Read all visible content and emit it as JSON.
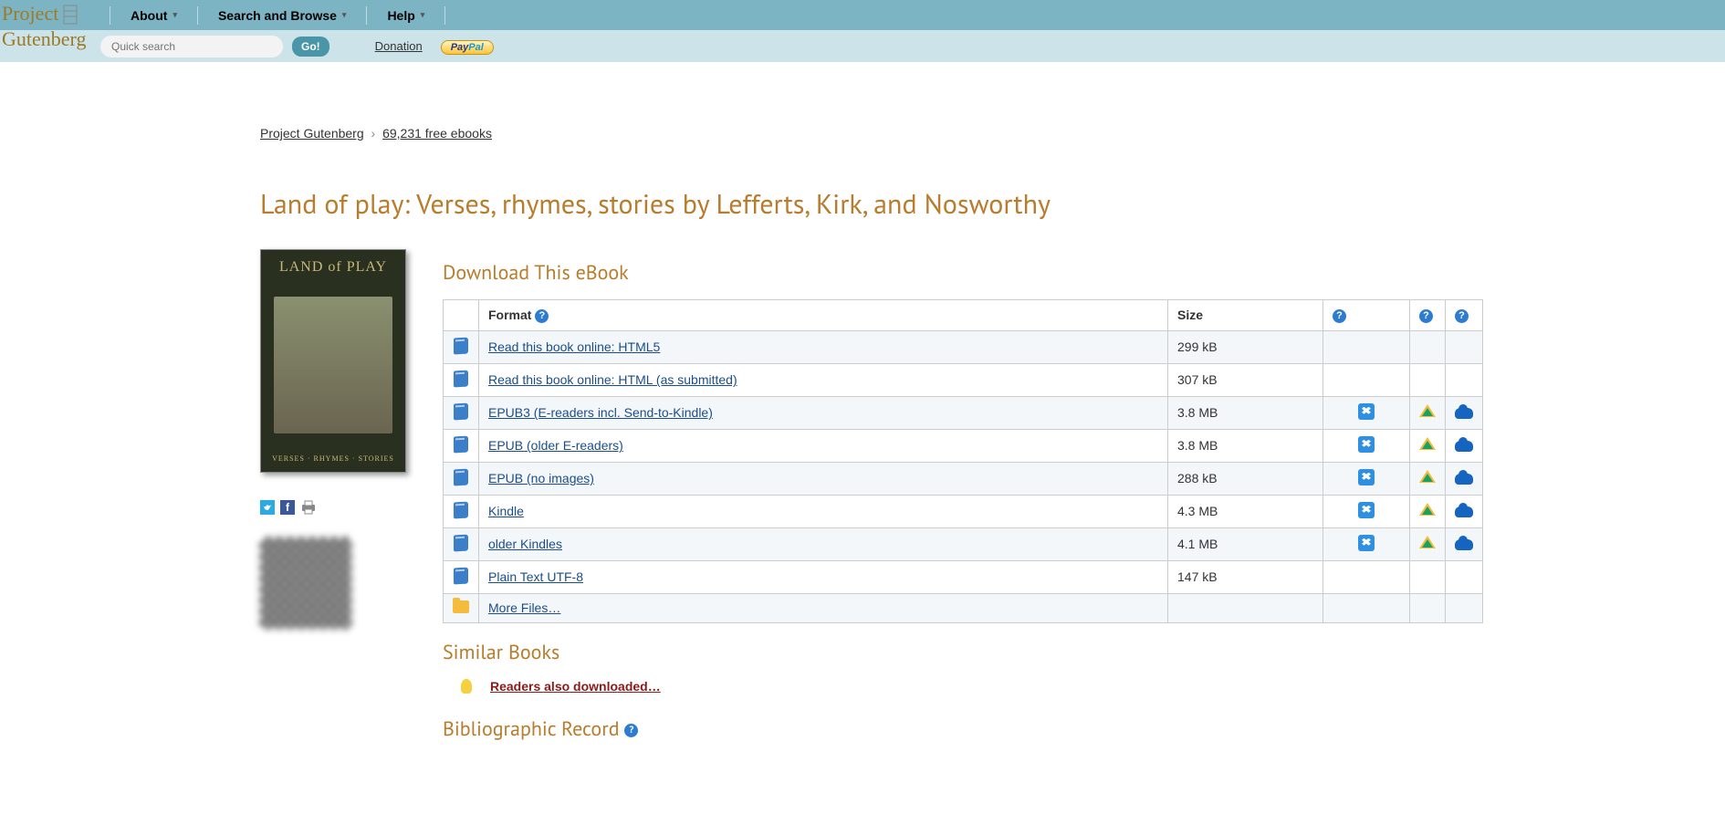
{
  "logo": {
    "line1": "Project",
    "line2": "Gutenberg"
  },
  "nav": {
    "about": "About",
    "search": "Search and Browse",
    "help": "Help"
  },
  "searchbar": {
    "placeholder": "Quick search",
    "go": "Go!",
    "donation": "Donation",
    "paypal_a": "Pay",
    "paypal_b": "Pal"
  },
  "breadcrumb": {
    "home": "Project Gutenberg",
    "count": "69,231 free ebooks"
  },
  "title": "Land of play: Verses, rhymes, stories by Lefferts, Kirk, and Nosworthy",
  "sections": {
    "download": "Download This eBook",
    "similar": "Similar Books",
    "bibrec": "Bibliographic Record"
  },
  "cover": {
    "title": "LAND of PLAY",
    "sub": "VERSES · RHYMES · STORIES"
  },
  "headers": {
    "format": "Format",
    "size": "Size"
  },
  "help_glyph": "?",
  "rows": [
    {
      "icon": "book",
      "label": "Read this book online: HTML5",
      "size": "299 kB",
      "dropbox": false,
      "gdrive": false,
      "onedrive": false
    },
    {
      "icon": "book",
      "label": "Read this book online: HTML (as submitted)",
      "size": "307 kB",
      "dropbox": false,
      "gdrive": false,
      "onedrive": false
    },
    {
      "icon": "book",
      "label": "EPUB3 (E-readers incl. Send-to-Kindle)",
      "size": "3.8 MB",
      "dropbox": true,
      "gdrive": true,
      "onedrive": true
    },
    {
      "icon": "book",
      "label": "EPUB (older E-readers)",
      "size": "3.8 MB",
      "dropbox": true,
      "gdrive": true,
      "onedrive": true
    },
    {
      "icon": "book",
      "label": "EPUB (no images)",
      "size": "288 kB",
      "dropbox": true,
      "gdrive": true,
      "onedrive": true
    },
    {
      "icon": "book",
      "label": "Kindle",
      "size": "4.3 MB",
      "dropbox": true,
      "gdrive": true,
      "onedrive": true
    },
    {
      "icon": "book",
      "label": "older Kindles",
      "size": "4.1 MB",
      "dropbox": true,
      "gdrive": true,
      "onedrive": true
    },
    {
      "icon": "book",
      "label": "Plain Text UTF-8",
      "size": "147 kB",
      "dropbox": false,
      "gdrive": false,
      "onedrive": false
    },
    {
      "icon": "folder",
      "label": "More Files…",
      "size": "",
      "dropbox": false,
      "gdrive": false,
      "onedrive": false
    }
  ],
  "similar": {
    "readers": "Readers also downloaded…"
  },
  "social": {
    "fb": "f"
  }
}
